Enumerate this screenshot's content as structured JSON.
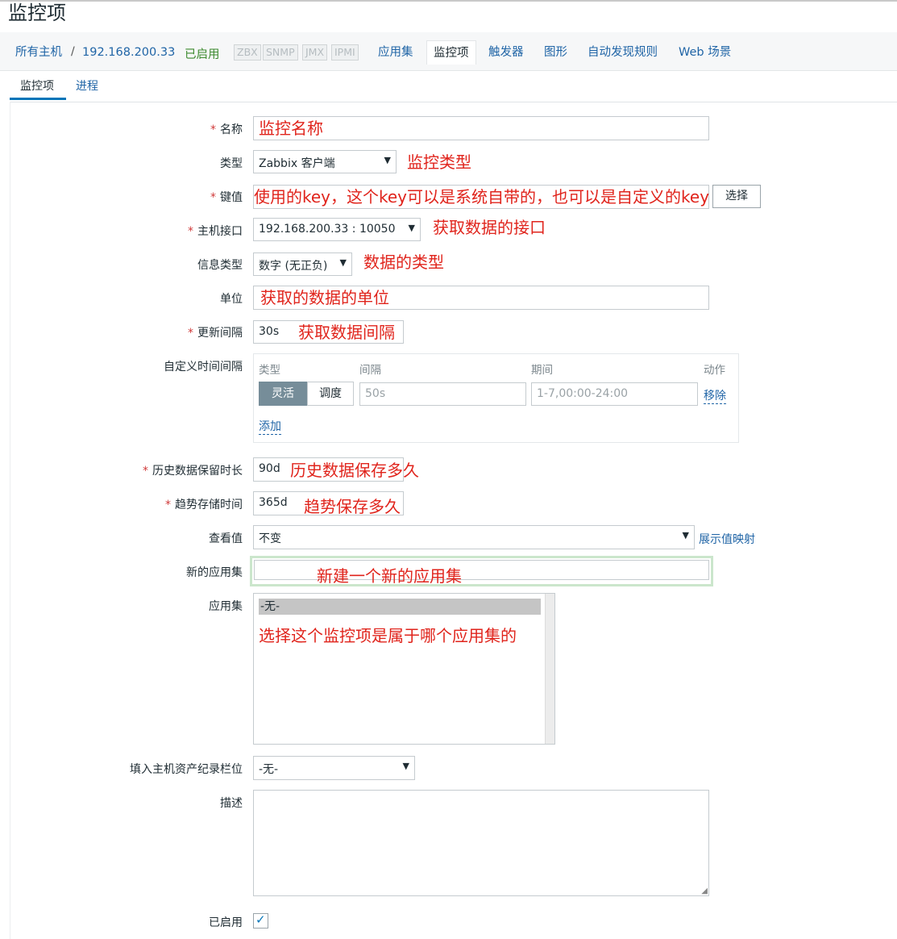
{
  "page": {
    "title": "监控项"
  },
  "nav": {
    "breadcrumb": {
      "all_hosts": "所有主机",
      "sep": "/",
      "host": "192.168.200.33"
    },
    "status": "已启用",
    "protocols": [
      "ZBX",
      "SNMP",
      "JMX",
      "IPMI"
    ],
    "links": {
      "applications": "应用集",
      "items": "监控项",
      "triggers": "触发器",
      "graphs": "图形",
      "discovery": "自动发现规则",
      "web": "Web 场景"
    }
  },
  "subtabs": {
    "item": "监控项",
    "process": "进程"
  },
  "form": {
    "name": {
      "label": "名称",
      "value": "",
      "annotation": "监控名称"
    },
    "type": {
      "label": "类型",
      "value": "Zabbix 客户端",
      "annotation": "监控类型"
    },
    "key": {
      "label": "键值",
      "annotation": "使用的key，这个key可以是系统自带的，也可以是自定义的key",
      "select_button": "选择"
    },
    "interface": {
      "label": "主机接口",
      "value": "192.168.200.33 : 10050",
      "annotation": "获取数据的接口"
    },
    "info_type": {
      "label": "信息类型",
      "value": "数字 (无正负)",
      "annotation": "数据的类型"
    },
    "units": {
      "label": "单位",
      "annotation": "获取的数据的单位"
    },
    "update_interval": {
      "label": "更新间隔",
      "value": "30s",
      "annotation": "获取数据间隔"
    },
    "custom_intervals": {
      "label": "自定义时间间隔",
      "col_type": "类型",
      "col_interval": "间隔",
      "col_period": "期间",
      "col_action": "动作",
      "opt_flexible": "灵活",
      "opt_scheduling": "调度",
      "interval_placeholder": "50s",
      "period_placeholder": "1-7,00:00-24:00",
      "remove": "移除",
      "add": "添加"
    },
    "history": {
      "label": "历史数据保留时长",
      "value": "90d",
      "annotation": "历史数据保存多久"
    },
    "trends": {
      "label": "趋势存储时间",
      "value": "365d",
      "annotation": "趋势保存多久"
    },
    "show_value": {
      "label": "查看值",
      "value": "不变",
      "link": "展示值映射"
    },
    "new_application": {
      "label": "新的应用集",
      "annotation": "新建一个新的应用集"
    },
    "applications": {
      "label": "应用集",
      "selected": "-无-",
      "annotation": "选择这个监控项是属于哪个应用集的"
    },
    "inventory": {
      "label": "填入主机资产纪录栏位",
      "value": "-无-"
    },
    "description": {
      "label": "描述"
    },
    "enabled": {
      "label": "已启用",
      "checked": true
    }
  },
  "colors": {
    "accent": "#0275b8",
    "annotation": "#e0241c",
    "link": "#1f64a6",
    "enabled_green": "#3c8a2e"
  }
}
